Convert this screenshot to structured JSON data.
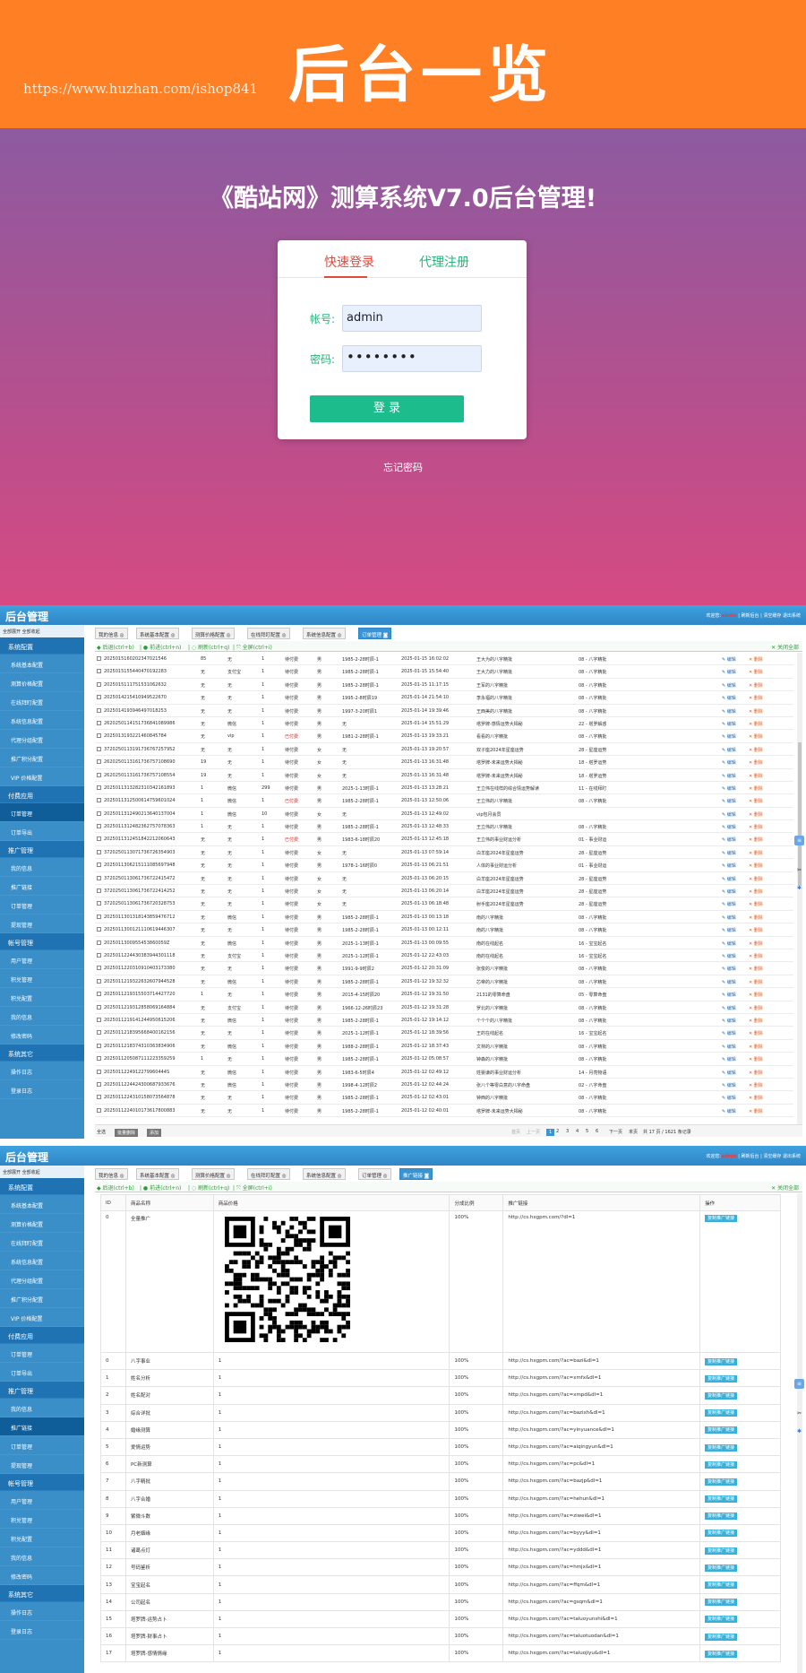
{
  "hero": {
    "watermark": "https://www.huzhan.com/ishop841",
    "title": "后台一览"
  },
  "login": {
    "title": "《酷站网》测算系统V7.0后台管理!",
    "tab_login": "快速登录",
    "tab_agent": "代理注册",
    "account_label": "帐号:",
    "account_value": "admin",
    "password_label": "密码:",
    "password_value": "••••••••",
    "submit": "登 录",
    "forgot": "忘记密码"
  },
  "admin": {
    "logo": "后台管理",
    "welcome_prefix": "欢迎您:",
    "user": "admin",
    "top_links": "| 刷新后台 | 清空缓存",
    "logout": "退出系统",
    "side_header": "全部展开 全部收起",
    "menu": [
      {
        "type": "sec",
        "label": "系统配置"
      },
      {
        "type": "it",
        "label": "系统基本配置"
      },
      {
        "type": "it",
        "label": "测算价格配置"
      },
      {
        "type": "it",
        "label": "在线拜盯配置"
      },
      {
        "type": "it",
        "label": "系统信息配置"
      },
      {
        "type": "it",
        "label": "代理分组配置"
      },
      {
        "type": "it",
        "label": "推广积分配置"
      },
      {
        "type": "it",
        "label": "VIP 价格配置"
      },
      {
        "type": "sec",
        "label": "付费应用"
      },
      {
        "type": "it",
        "label": "订单管理"
      },
      {
        "type": "it",
        "label": "订单导出"
      },
      {
        "type": "sec",
        "label": "推广管理"
      },
      {
        "type": "it",
        "label": "我的信息"
      },
      {
        "type": "it",
        "label": "推广链接"
      },
      {
        "type": "it",
        "label": "订单管理"
      },
      {
        "type": "it",
        "label": "提现管理"
      },
      {
        "type": "sec",
        "label": "帐号管理"
      },
      {
        "type": "it",
        "label": "用户管理"
      },
      {
        "type": "it",
        "label": "积兑管理"
      },
      {
        "type": "it",
        "label": "积兑配置"
      },
      {
        "type": "it",
        "label": "我的信息"
      },
      {
        "type": "it",
        "label": "修改密码"
      },
      {
        "type": "sec",
        "label": "系统其它"
      },
      {
        "type": "it",
        "label": "操作日志"
      },
      {
        "type": "it",
        "label": "登录日志"
      }
    ],
    "tabs_a": [
      "我的信息 ◎",
      "系统基本配置 ◎",
      "测算价格配置 ◎",
      "在线拜盯配置 ◎",
      "系统信息配置 ◎",
      "订单管理 ◙"
    ],
    "tabs_b": [
      "我的信息 ◎",
      "系统基本配置 ◎",
      "测算价格配置 ◎",
      "在线拜盯配置 ◎",
      "系统信息配置 ◎",
      "订单管理 ◎",
      "推广链接 ◙"
    ],
    "toolbar": [
      "◆ 后退(ctrl+b)",
      "| ● 前进(ctrl+n)",
      "| ◌ 刷新(ctrl+q)",
      "| ⤧ 全屏(ctrl+i)"
    ],
    "close_all": "✕ 关闭全部",
    "edit": "✎ 编辑",
    "del": "✕ 删除",
    "orders": [
      [
        "2025015160202347021546",
        "85",
        "无",
        "1",
        "待付费",
        "男",
        "1985-2-28时辰-1",
        "2025-01-15 16:02:02",
        "王大为的八字精批",
        "08 - 八字精批"
      ],
      [
        "2025015155440470192283",
        "无",
        "支付宝",
        "1",
        "待付费",
        "男",
        "1985-2-28时辰-1",
        "2025-01-15 15:54:40",
        "王大力的八字精批",
        "08 - 八字精批"
      ],
      [
        "2025015111751531062632",
        "无",
        "无",
        "1",
        "待付费",
        "男",
        "1985-2-28时辰-1",
        "2025-01-15 11:17:15",
        "王军的八字精批",
        "08 - 八字精批"
      ],
      [
        "2025014215410949522670",
        "无",
        "无",
        "1",
        "待付费",
        "男",
        "1995-2-8时辰19",
        "2025-01-14 21:54:10",
        "李永福的八字精批",
        "08 - 八字精批"
      ],
      [
        "2025014193946497018253",
        "无",
        "无",
        "1",
        "待付费",
        "男",
        "1997-3-20时辰1",
        "2025-01-14 19:39:46",
        "王西美的八字精批",
        "08 - 八字精批"
      ],
      [
        "2620250114151736841089986",
        "无",
        "微信",
        "1",
        "待付费",
        "男",
        "无",
        "2025-01-14 15:51:29",
        "塔罗牌-感情运势大揭秘",
        "22 - 塔罗解惑"
      ],
      [
        "2025013193221460845784",
        "无",
        "vip",
        "1",
        "已付费",
        "男",
        "1981-2-28时辰-1",
        "2025-01-13 19:33:21",
        "看看的八字精批",
        "08 - 八字精批"
      ],
      [
        "3720250113191736767257952",
        "无",
        "无",
        "1",
        "待付费",
        "女",
        "无",
        "2025-01-13 19:20:57",
        "双子座2024年星座运势",
        "28 - 星座运势"
      ],
      [
        "2620250113161736757108690",
        "19",
        "无",
        "1",
        "待付费",
        "女",
        "无",
        "2025-01-13 16:31:48",
        "塔罗牌-未来运势大揭秘",
        "18 - 塔罗运势"
      ],
      [
        "2620250113161736757108554",
        "19",
        "无",
        "1",
        "待付费",
        "女",
        "无",
        "2025-01-13 16:31:48",
        "塔罗牌-未来运势大揭秘",
        "18 - 塔罗运势"
      ],
      [
        "2025011313282310342161893",
        "1",
        "微信",
        "299",
        "待付费",
        "男",
        "2025-1-13时辰-1",
        "2025-01-13 13:28:21",
        "王立伟在线样的综合情运势解读",
        "11 - 在线拜盯"
      ],
      [
        "2025011312500614759601024",
        "1",
        "微信",
        "1",
        "已付费",
        "男",
        "1985-2-28时辰-1",
        "2025-01-13 12:50:06",
        "王立伟的八字精批",
        "08 - 八字精批"
      ],
      [
        "2025011312490213640137004",
        "1",
        "微信",
        "10",
        "待付费",
        "女",
        "无",
        "2025-01-13 12:49:02",
        "vip包月会员",
        ""
      ],
      [
        "2025011312482362757078363",
        "1",
        "无",
        "1",
        "待付费",
        "男",
        "1985-2-28时辰-1",
        "2025-01-13 12:48:33",
        "王立伟的八字精批",
        "08 - 八字精批"
      ],
      [
        "2025011312451842212060643",
        "无",
        "无",
        "1",
        "已付费",
        "男",
        "1983-6-18时辰20",
        "2025-01-13 12:45:18",
        "王立伟的事业财运分析",
        "01 - 事业财运"
      ],
      [
        "3720250113071736726354903",
        "无",
        "无",
        "1",
        "待付费",
        "女",
        "无",
        "2025-01-13 07:59:14",
        "白羊座2024年星座运势",
        "28 - 星座运势"
      ],
      [
        "2025011306215111085697948",
        "无",
        "无",
        "1",
        "待付费",
        "男",
        "1978-1-16时辰0",
        "2025-01-13 06:21:51",
        "人体的事业财运分析",
        "01 - 事业财运"
      ],
      [
        "3720250113061736722415472",
        "无",
        "无",
        "1",
        "待付费",
        "女",
        "无",
        "2025-01-13 06:20:15",
        "白羊座2024年星座运势",
        "28 - 星座运势"
      ],
      [
        "3720250113061736722414252",
        "无",
        "无",
        "1",
        "待付费",
        "女",
        "无",
        "2025-01-13 06:20:14",
        "白羊座2024年星座运势",
        "28 - 星座运势"
      ],
      [
        "3720250113061736720328753",
        "无",
        "无",
        "1",
        "待付费",
        "女",
        "无",
        "2025-01-13 06:18:48",
        "射手座2024年星座运势",
        "28 - 星座运势"
      ],
      [
        "2025011301318143859476712",
        "无",
        "微信",
        "1",
        "待付费",
        "男",
        "1985-2-28时辰-1",
        "2025-01-13 00:13:18",
        "南的八字精批",
        "08 - 八字精批"
      ],
      [
        "2025011300121110619446307",
        "无",
        "无",
        "1",
        "待付费",
        "男",
        "1985-2-28时辰-1",
        "2025-01-13 00:12:11",
        "南的八字精批",
        "08 - 八字精批"
      ],
      [
        "2025011300955453860059Z",
        "无",
        "微信",
        "1",
        "待付费",
        "男",
        "2025-1-13时辰-1",
        "2025-01-13 00:09:55",
        "南的在线起名",
        "16 - 宝宝起名"
      ],
      [
        "2025011224430383944301118",
        "无",
        "支付宝",
        "1",
        "待付费",
        "男",
        "2025-1-12时辰-1",
        "2025-01-12 22:43:03",
        "南的在线起名",
        "16 - 宝宝起名"
      ],
      [
        "2025011220310910403173380",
        "无",
        "无",
        "1",
        "待付费",
        "男",
        "1991-9-9时辰2",
        "2025-01-12 20:31:09",
        "张俊的八字精批",
        "08 - 八字精批"
      ],
      [
        "2025011219322632607944528",
        "无",
        "微信",
        "1",
        "待付费",
        "男",
        "1985-2-28时辰-1",
        "2025-01-12 19:32:32",
        "芯帝的八字精批",
        "08 - 八字精批"
      ],
      [
        "2025011219315503714427720",
        "1",
        "无",
        "1",
        "待付费",
        "男",
        "2015-4-15时辰20",
        "2025-01-12 19:31:50",
        "2131的零算命盘",
        "05 - 零算命盘"
      ],
      [
        "2025011219312858069164884",
        "无",
        "支付宝",
        "1",
        "待付费",
        "男",
        "1966-12-26时辰23",
        "2025-01-12 19:31:28",
        "罗北的八字精批",
        "08 - 八字精批"
      ],
      [
        "2025011219141244950615206",
        "无",
        "微信",
        "1",
        "待付费",
        "男",
        "1985-2-28时辰-1",
        "2025-01-12 19:14:12",
        "个个个的八字精批",
        "08 - 八字精批"
      ],
      [
        "2025011218395668400162156",
        "无",
        "无",
        "1",
        "待付费",
        "男",
        "2025-1-12时辰-1",
        "2025-01-12 18:39:56",
        "王的在线起名",
        "16 - 宝宝起名"
      ],
      [
        "2025011218374310363834906",
        "无",
        "微信",
        "1",
        "待付费",
        "男",
        "1988-2-28时辰-1",
        "2025-01-12 18:37:43",
        "文林的八字精批",
        "08 - 八字精批"
      ],
      [
        "2025011205087111223359259",
        "1",
        "无",
        "1",
        "待付费",
        "男",
        "1985-2-28时辰-1",
        "2025-01-12 05:08:57",
        "钟森的八字精批",
        "08 - 八字精批"
      ],
      [
        "2025011224912279960444S",
        "无",
        "微信",
        "1",
        "待付费",
        "男",
        "1983-6-5时辰4",
        "2025-01-12 02:49:12",
        "姓婴谦的事业财运分析",
        "14 - 月亮物语"
      ],
      [
        "2025011224424300687933676",
        "无",
        "微信",
        "1",
        "待付费",
        "男",
        "1998-4-12时辰2",
        "2025-01-12 02:44:24",
        "张八个等零白意的八字命盘",
        "02 - 八字命盘"
      ],
      [
        "2025011224310158073564878",
        "无",
        "无",
        "1",
        "待付费",
        "男",
        "1985-2-28时辰-1",
        "2025-01-12 02:43:01",
        "钟西的八字精批",
        "08 - 八字精批"
      ],
      [
        "2025011224010173617800883",
        "无",
        "无",
        "1",
        "待付费",
        "男",
        "1985-2-28时辰-1",
        "2025-01-12 02:40:01",
        "塔罗牌-未来运势大揭秘",
        "08 - 八字精批"
      ]
    ],
    "pager": {
      "select_all": "全选",
      "batch_del": "批量删除",
      "add": "添加",
      "first": "首页",
      "prev": "上一页",
      "pages": [
        "1",
        "2",
        "3",
        "4",
        "5",
        "6"
      ],
      "next": "下一页",
      "last": "末页",
      "info": "共 17 页 / 1621 条记录"
    },
    "promo_headers": [
      "ID",
      "商品名称",
      "商品价格",
      "分成比例",
      "推广链接",
      "操作"
    ],
    "promo_first": [
      "0",
      "全量推广",
      "",
      "100%",
      "http://cs.hxgpm.com/?dl=1",
      "复制推广链接"
    ],
    "promo_rows": [
      [
        "0",
        "八字事业",
        "1",
        "100%",
        "http://cs.hxgpm.com/?ac=bazi&dl=1"
      ],
      [
        "1",
        "姓名分析",
        "1",
        "100%",
        "http://cs.hxgpm.com/?ac=xmfx&dl=1"
      ],
      [
        "2",
        "姓名配对",
        "1",
        "100%",
        "http://cs.hxgpm.com/?ac=xmpd&dl=1"
      ],
      [
        "3",
        "综合详批",
        "1",
        "100%",
        "http://cs.hxgpm.com/?ac=bazixh&dl=1"
      ],
      [
        "4",
        "婚缘测算",
        "1",
        "100%",
        "http://cs.hxgpm.com/?ac=yinyuance&dl=1"
      ],
      [
        "5",
        "爱情运势",
        "1",
        "100%",
        "http://cs.hxgpm.com/?ac=aiqingyun&dl=1"
      ],
      [
        "6",
        "PC新测算",
        "1",
        "100%",
        "http://cs.hxgpm.com/?ac=pc&dl=1"
      ],
      [
        "7",
        "八字精批",
        "1",
        "100%",
        "http://cs.hxgpm.com/?ac=bazjp&dl=1"
      ],
      [
        "8",
        "八字合婚",
        "1",
        "100%",
        "http://cs.hxgpm.com/?ac=hehun&dl=1"
      ],
      [
        "9",
        "紫微斗数",
        "1",
        "100%",
        "http://cs.hxgpm.com/?ac=ziwei&dl=1"
      ],
      [
        "10",
        "月老姻缘",
        "1",
        "100%",
        "http://cs.hxgpm.com/?ac=byyy&dl=1"
      ],
      [
        "11",
        "诸葛点灯",
        "1",
        "100%",
        "http://cs.hxgpm.com/?ac=yddd&dl=1"
      ],
      [
        "12",
        "号码鉴析",
        "1",
        "100%",
        "http://cs.hxgpm.com/?ac=hmjx&dl=1"
      ],
      [
        "13",
        "宝宝起名",
        "1",
        "100%",
        "http://cs.hxgpm.com/?ac=ffqm&dl=1"
      ],
      [
        "14",
        "公司起名",
        "1",
        "100%",
        "http://cs.hxgpm.com/?ac=gsqm&dl=1"
      ],
      [
        "15",
        "塔罗牌-运势占卜",
        "1",
        "100%",
        "http://cs.hxgpm.com/?ac=taluoyunshi&dl=1"
      ],
      [
        "16",
        "塔罗牌-财事占卜",
        "1",
        "100%",
        "http://cs.hxgpm.com/?ac=taluotuodan&dl=1"
      ],
      [
        "17",
        "塔罗牌-感情情缘",
        "1",
        "100%",
        "http://cs.hxgpm.com/?ac=taluojiyu&dl=1"
      ]
    ],
    "copy_btn": "复制推广链接"
  }
}
